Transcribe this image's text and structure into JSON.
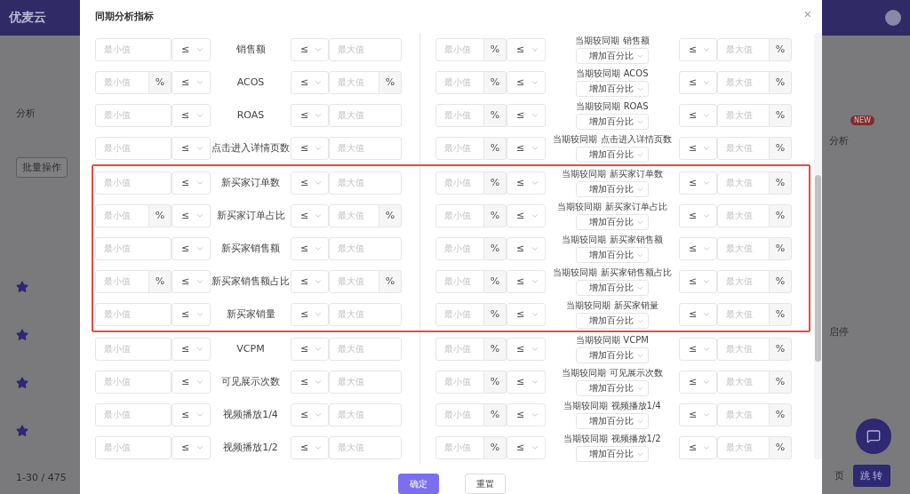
{
  "background_left": {
    "logo": "优麦云",
    "tab": "分析",
    "batch_button": "批量操作",
    "pagination": "1-30 / 475"
  },
  "background_right": {
    "analysis_button": "分析",
    "new_badge": "NEW",
    "toggle_label": "启停",
    "page_label": "页",
    "jump_button": "跳 转"
  },
  "dialog": {
    "title": "同期分析指标",
    "close": "×",
    "rows": [
      {
        "highlighted": false,
        "left": {
          "min": {
            "placeholder": "最小值"
          },
          "op1": "≤",
          "label": "销售额",
          "op2": "≤",
          "max": {
            "placeholder": "最大值"
          }
        },
        "right": {
          "min": {
            "placeholder": "最小值",
            "unit": "%"
          },
          "op1": "≤",
          "label": "当期较同期 销售额",
          "change": "增加百分比",
          "op2": "≤",
          "max": {
            "placeholder": "最大值",
            "unit": "%"
          }
        }
      },
      {
        "highlighted": false,
        "left": {
          "min": {
            "placeholder": "最小值",
            "unit": "%"
          },
          "op1": "≤",
          "label": "ACOS",
          "op2": "≤",
          "max": {
            "placeholder": "最大值",
            "unit": "%"
          }
        },
        "right": {
          "min": {
            "placeholder": "最小值",
            "unit": "%"
          },
          "op1": "≤",
          "label": "当期较同期 ACOS",
          "change": "增加百分比",
          "op2": "≤",
          "max": {
            "placeholder": "最大值",
            "unit": "%"
          }
        }
      },
      {
        "highlighted": false,
        "left": {
          "min": {
            "placeholder": "最小值"
          },
          "op1": "≤",
          "label": "ROAS",
          "op2": "≤",
          "max": {
            "placeholder": "最大值"
          }
        },
        "right": {
          "min": {
            "placeholder": "最小值",
            "unit": "%"
          },
          "op1": "≤",
          "label": "当期较同期 ROAS",
          "change": "增加百分比",
          "op2": "≤",
          "max": {
            "placeholder": "最大值",
            "unit": "%"
          }
        }
      },
      {
        "highlighted": false,
        "left": {
          "min": {
            "placeholder": "最小值"
          },
          "op1": "≤",
          "label": "点击进入详情页数",
          "op2": "≤",
          "max": {
            "placeholder": "最大值"
          }
        },
        "right": {
          "min": {
            "placeholder": "最小值",
            "unit": "%"
          },
          "op1": "≤",
          "label": "当期较同期 点击进入详情页数",
          "change": "增加百分比",
          "op2": "≤",
          "max": {
            "placeholder": "最大值",
            "unit": "%"
          }
        }
      },
      {
        "highlighted": true,
        "left": {
          "min": {
            "placeholder": "最小值"
          },
          "op1": "≤",
          "label": "新买家订单数",
          "op2": "≤",
          "max": {
            "placeholder": "最大值"
          }
        },
        "right": {
          "min": {
            "placeholder": "最小值",
            "unit": "%"
          },
          "op1": "≤",
          "label": "当期较同期 新买家订单数",
          "change": "增加百分比",
          "op2": "≤",
          "max": {
            "placeholder": "最大值",
            "unit": "%"
          }
        }
      },
      {
        "highlighted": true,
        "left": {
          "min": {
            "placeholder": "最小值",
            "unit": "%"
          },
          "op1": "≤",
          "label": "新买家订单占比",
          "op2": "≤",
          "max": {
            "placeholder": "最大值",
            "unit": "%"
          }
        },
        "right": {
          "min": {
            "placeholder": "最小值",
            "unit": "%"
          },
          "op1": "≤",
          "label": "当期较同期 新买家订单占比",
          "change": "增加百分比",
          "op2": "≤",
          "max": {
            "placeholder": "最大值",
            "unit": "%"
          }
        }
      },
      {
        "highlighted": true,
        "left": {
          "min": {
            "placeholder": "最小值"
          },
          "op1": "≤",
          "label": "新买家销售额",
          "op2": "≤",
          "max": {
            "placeholder": "最大值"
          }
        },
        "right": {
          "min": {
            "placeholder": "最小值",
            "unit": "%"
          },
          "op1": "≤",
          "label": "当期较同期 新买家销售额",
          "change": "增加百分比",
          "op2": "≤",
          "max": {
            "placeholder": "最大值",
            "unit": "%"
          }
        }
      },
      {
        "highlighted": true,
        "left": {
          "min": {
            "placeholder": "最小值",
            "unit": "%"
          },
          "op1": "≤",
          "label": "新买家销售额占比",
          "op2": "≤",
          "max": {
            "placeholder": "最大值",
            "unit": "%"
          }
        },
        "right": {
          "min": {
            "placeholder": "最小值",
            "unit": "%"
          },
          "op1": "≤",
          "label": "当期较同期 新买家销售额占比",
          "change": "增加百分比",
          "op2": "≤",
          "max": {
            "placeholder": "最大值",
            "unit": "%"
          }
        }
      },
      {
        "highlighted": true,
        "left": {
          "min": {
            "placeholder": "最小值"
          },
          "op1": "≤",
          "label": "新买家销量",
          "op2": "≤",
          "max": {
            "placeholder": "最大值"
          }
        },
        "right": {
          "min": {
            "placeholder": "最小值",
            "unit": "%"
          },
          "op1": "≤",
          "label": "当期较同期 新买家销量",
          "change": "增加百分比",
          "op2": "≤",
          "max": {
            "placeholder": "最大值",
            "unit": "%"
          }
        }
      },
      {
        "highlighted": false,
        "left": {
          "min": {
            "placeholder": "最小值"
          },
          "op1": "≤",
          "label": "VCPM",
          "op2": "≤",
          "max": {
            "placeholder": "最大值"
          }
        },
        "right": {
          "min": {
            "placeholder": "最小值",
            "unit": "%"
          },
          "op1": "≤",
          "label": "当期较同期 VCPM",
          "change": "增加百分比",
          "op2": "≤",
          "max": {
            "placeholder": "最大值",
            "unit": "%"
          }
        }
      },
      {
        "highlighted": false,
        "left": {
          "min": {
            "placeholder": "最小值"
          },
          "op1": "≤",
          "label": "可见展示次数",
          "op2": "≤",
          "max": {
            "placeholder": "最大值"
          }
        },
        "right": {
          "min": {
            "placeholder": "最小值",
            "unit": "%"
          },
          "op1": "≤",
          "label": "当期较同期 可见展示次数",
          "change": "增加百分比",
          "op2": "≤",
          "max": {
            "placeholder": "最大值",
            "unit": "%"
          }
        }
      },
      {
        "highlighted": false,
        "left": {
          "min": {
            "placeholder": "最小值"
          },
          "op1": "≤",
          "label": "视频播放1/4",
          "op2": "≤",
          "max": {
            "placeholder": "最大值"
          }
        },
        "right": {
          "min": {
            "placeholder": "最小值",
            "unit": "%"
          },
          "op1": "≤",
          "label": "当期较同期 视频播放1/4",
          "change": "增加百分比",
          "op2": "≤",
          "max": {
            "placeholder": "最大值",
            "unit": "%"
          }
        }
      },
      {
        "highlighted": false,
        "left": {
          "min": {
            "placeholder": "最小值"
          },
          "op1": "≤",
          "label": "视频播放1/2",
          "op2": "≤",
          "max": {
            "placeholder": "最大值"
          }
        },
        "right": {
          "min": {
            "placeholder": "最小值",
            "unit": "%"
          },
          "op1": "≤",
          "label": "当期较同期 视频播放1/2",
          "change": "增加百分比",
          "op2": "≤",
          "max": {
            "placeholder": "最大值",
            "unit": "%"
          }
        }
      }
    ],
    "buttons": [
      {
        "label": "确定",
        "kind": "primary"
      },
      {
        "label": "重置",
        "kind": "default"
      }
    ]
  }
}
